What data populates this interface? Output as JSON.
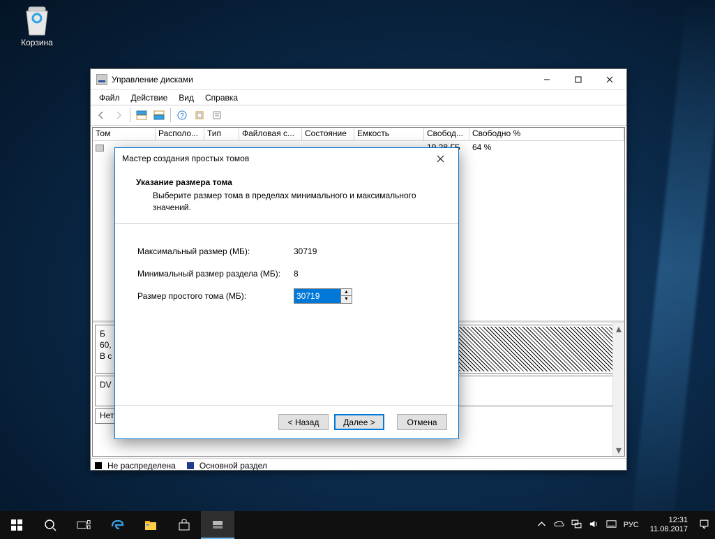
{
  "desktop": {
    "recycle_bin": "Корзина"
  },
  "window": {
    "title": "Управление дисками",
    "menu": {
      "file": "Файл",
      "action": "Действие",
      "view": "Вид",
      "help": "Справка"
    },
    "columns": {
      "volume": "Том",
      "layout": "Располо...",
      "type": "Тип",
      "fs": "Файловая с...",
      "status": "Состояние",
      "capacity": "Емкость",
      "free": "Свобод...",
      "freepct": "Свободно %"
    },
    "row": {
      "free": "19,28 ГБ",
      "freepct": "64 %"
    },
    "lower": {
      "disk0_prefix": "Б",
      "disk0_size": "60,",
      "disk0_status": "В с",
      "dvd": "DV",
      "no_media": "Нет носителя"
    },
    "legend": {
      "unallocated": "Не распределена",
      "primary": "Основной раздел"
    }
  },
  "wizard": {
    "title": "Мастер создания простых томов",
    "header": "Указание размера тома",
    "sub": "Выберите размер тома в пределах минимального и максимального значений.",
    "max_label": "Максимальный размер (МБ):",
    "max_value": "30719",
    "min_label": "Минимальный размер раздела (МБ):",
    "min_value": "8",
    "size_label": "Размер простого тома (МБ):",
    "size_value": "30719",
    "back": "< Назад",
    "next": "Далее >",
    "cancel": "Отмена"
  },
  "taskbar": {
    "lang": "РУС",
    "time": "12:31",
    "date": "11.08.2017"
  }
}
